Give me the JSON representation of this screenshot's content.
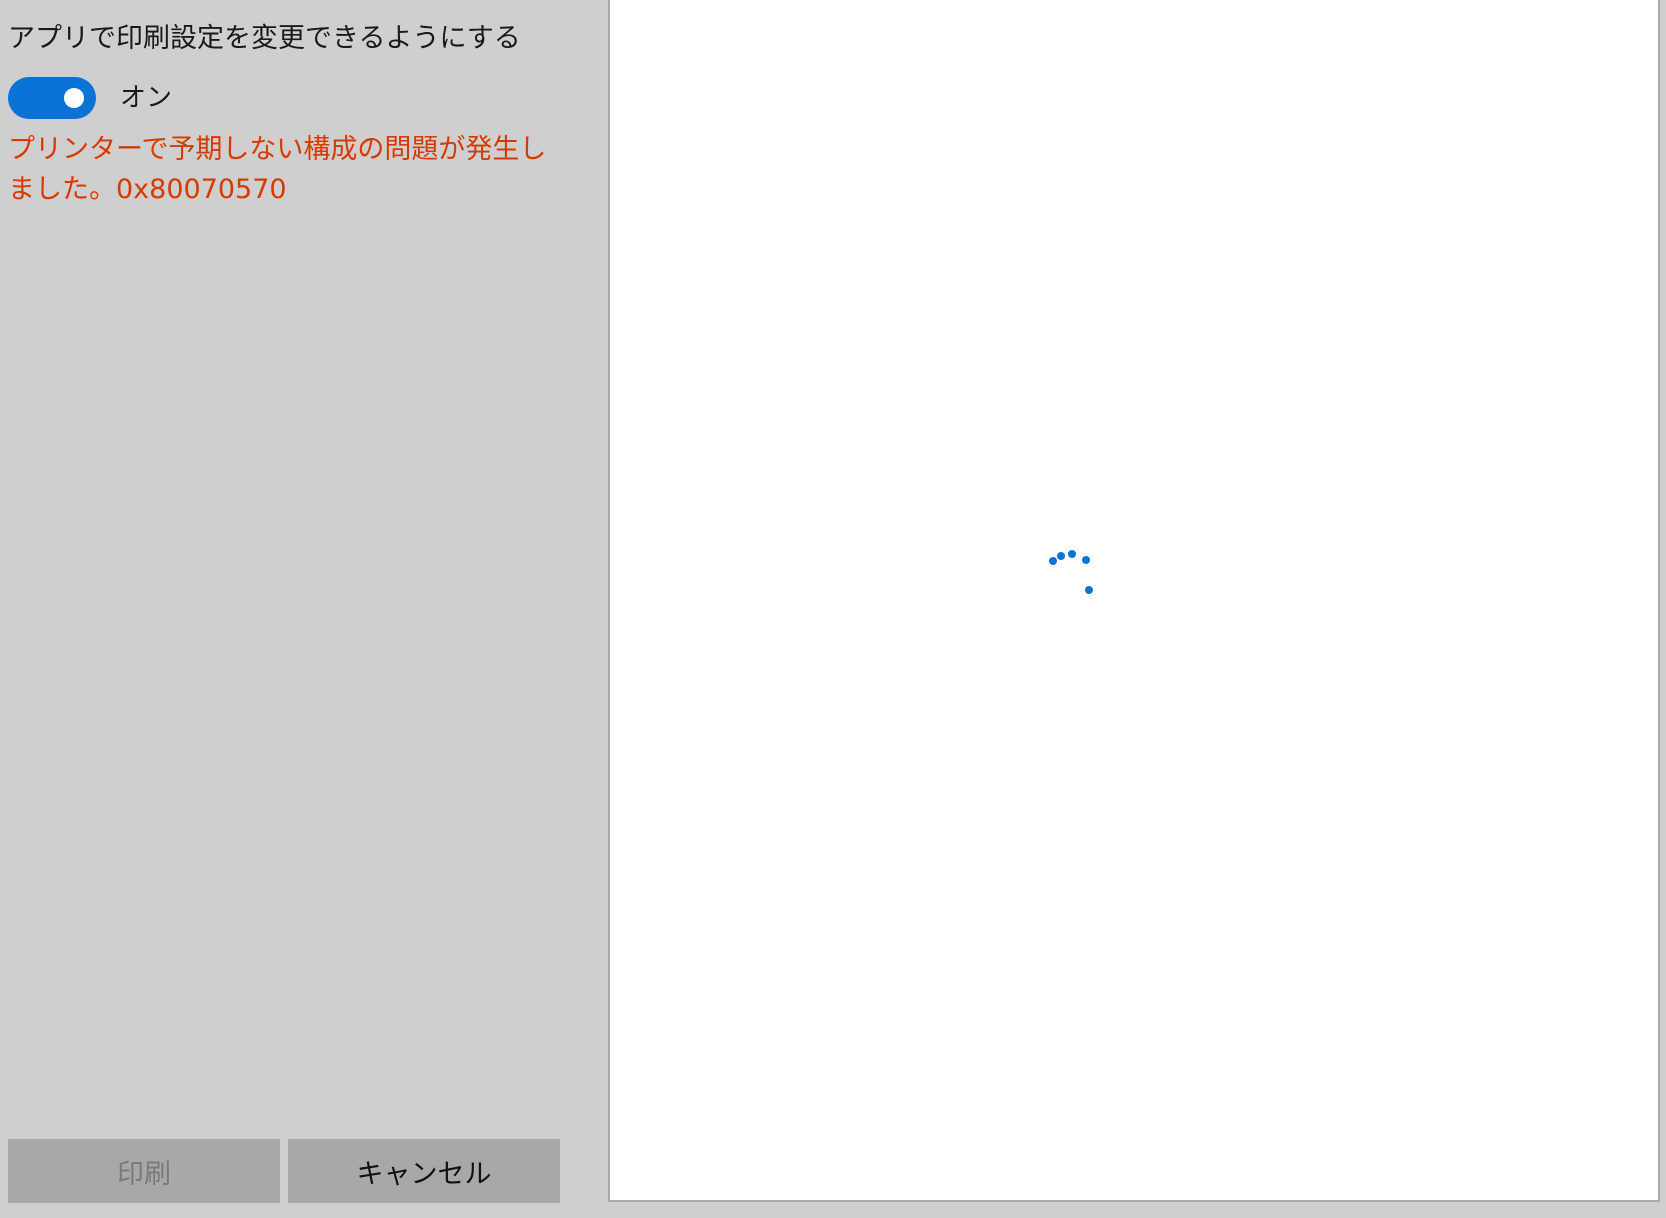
{
  "settings": {
    "allow_app_change_label": "アプリで印刷設定を変更できるようにする",
    "toggle_state_label": "オン",
    "toggle_on": true
  },
  "error": {
    "message": "プリンターで予期しない構成の問題が発生しました。0x80070570"
  },
  "buttons": {
    "print_label": "印刷",
    "cancel_label": "キャンセル"
  },
  "colors": {
    "accent": "#0a74d6",
    "error": "#d83b01",
    "panel_bg": "#cfcfcf",
    "button_bg": "#a8a8a8"
  },
  "preview": {
    "loading_icon": "loading-spinner-icon"
  }
}
